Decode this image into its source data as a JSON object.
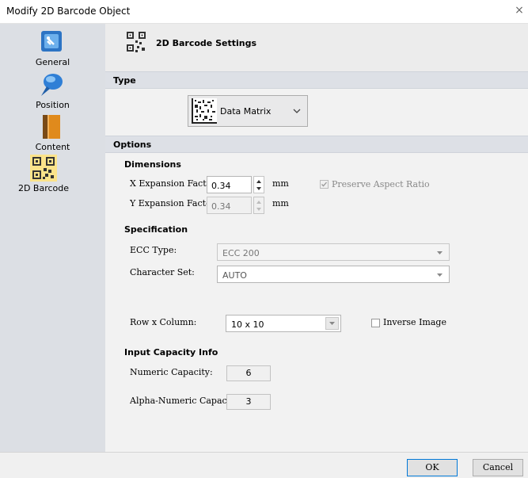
{
  "window": {
    "title": "Modify 2D Barcode Object",
    "close_glyph": "×"
  },
  "sidebar": {
    "items": [
      {
        "label": "General",
        "icon": "general-tag-icon"
      },
      {
        "label": "Position",
        "icon": "position-pin-icon"
      },
      {
        "label": "Content",
        "icon": "content-book-icon"
      },
      {
        "label": "2D Barcode",
        "icon": "qr-code-icon"
      }
    ]
  },
  "main": {
    "header_title": "2D Barcode Settings",
    "type_section": "Type",
    "type_value": "Data Matrix",
    "options_section": "Options",
    "dimensions": {
      "heading": "Dimensions",
      "x_label": "X Expansion Factor:",
      "x_value": "0.34",
      "x_unit": "mm",
      "y_label": "Y Expansion Factor:",
      "y_value": "0.34",
      "y_unit": "mm",
      "preserve_label": "Preserve Aspect Ratio",
      "preserve_checked": true
    },
    "specification": {
      "heading": "Specification",
      "ecc_label": "ECC Type:",
      "ecc_value": "ECC 200",
      "charset_label": "Character Set:",
      "charset_value": "AUTO",
      "rowcol_label": "Row x Column:",
      "rowcol_value": "10 x  10",
      "inverse_label": "Inverse Image",
      "inverse_checked": false
    },
    "capacity": {
      "heading": "Input Capacity Info",
      "numeric_label": "Numeric Capacity:",
      "numeric_value": "6",
      "alnum_label": "Alpha-Numeric Capacity:",
      "alnum_value": "3"
    }
  },
  "footer": {
    "ok_label": "OK",
    "cancel_label": "Cancel"
  },
  "colors": {
    "sidebar_bg": "#dcdfe4",
    "main_bg": "#f2f2f2",
    "section_bg": "#dde0e6",
    "accent": "#0078d7"
  }
}
